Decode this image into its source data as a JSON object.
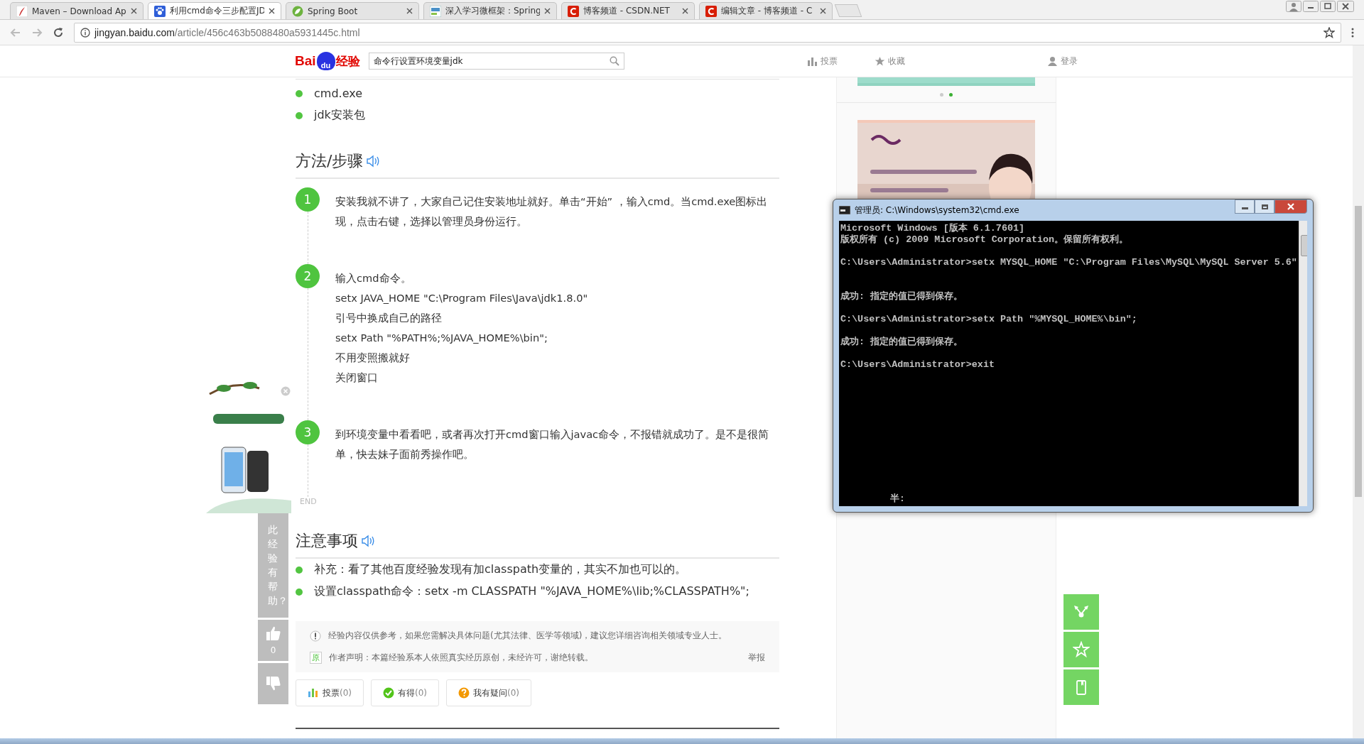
{
  "browser": {
    "tabs": [
      {
        "title": "Maven – Download Ap",
        "kind": "maven",
        "selected": false
      },
      {
        "title": "利用cmd命令三步配置JD",
        "kind": "paw",
        "selected": true
      },
      {
        "title": "Spring Boot",
        "kind": "leaf",
        "selected": false
      },
      {
        "title": "深入学习微框架：Spring",
        "kind": "info",
        "selected": false
      },
      {
        "title": "博客频道 - CSDN.NET",
        "kind": "csdn",
        "selected": false
      },
      {
        "title": "编辑文章 - 博客频道 - C",
        "kind": "csdn",
        "selected": false
      }
    ],
    "url": {
      "host": "jingyan.baidu.com",
      "path": "/article/456c463b5088480a5931445c.html"
    }
  },
  "header": {
    "logo": {
      "left": "Bai",
      "paw": "du",
      "right": "经验"
    },
    "search": {
      "value": "命令行设置环境变量jdk"
    },
    "nav": [
      {
        "label": "投票",
        "kind": "vote"
      },
      {
        "label": "收藏",
        "kind": "star"
      },
      {
        "label": "登录",
        "kind": "user"
      }
    ]
  },
  "article": {
    "tools": [
      "cmd.exe",
      "jdk安装包"
    ],
    "steps_heading": "方法/步骤",
    "steps": [
      {
        "number": "1",
        "lines": [
          "安装我就不讲了，大家自己记住安装地址就好。单击“开始” ，输入cmd。当cmd.exe图标出现，点击右键，选择以管理员身份运行。"
        ]
      },
      {
        "number": "2",
        "lines": [
          "输入cmd命令。",
          "setx JAVA_HOME \"C:\\Program Files\\Java\\jdk1.8.0\"",
          "引号中换成自己的路径",
          "setx Path \"%PATH%;%JAVA_HOME%\\bin\";",
          "不用变照搬就好",
          "关闭窗口"
        ]
      },
      {
        "number": "3",
        "lines": [
          "到环境变量中看看吧，或者再次打开cmd窗口输入javac命令，不报错就成功了。是不是很简单，快去妹子面前秀操作吧。"
        ]
      }
    ],
    "end_label": "END",
    "notes_heading": "注意事项",
    "notes": [
      "补充：看了其他百度经验发现有加classpath变量的，其实不加也可以的。",
      "设置classpath命令：setx -m CLASSPATH \"%JAVA_HOME%\\lib;%CLASSPATH%\";"
    ],
    "disclaimer": {
      "notice": "经验内容仅供参考，如果您需解决具体问题(尤其法律、医学等领域)，建议您详细咨询相关领域专业人士。",
      "badge": "原",
      "statement": "作者声明：本篇经验系本人依照真实经历原创，未经许可，谢绝转载。",
      "report": "举报"
    },
    "actions": [
      {
        "label": "投票",
        "count": "(0)",
        "kind": "vote"
      },
      {
        "label": "有得",
        "count": "(0)",
        "kind": "gain"
      },
      {
        "label": "我有疑问",
        "count": "(0)",
        "kind": "question"
      }
    ]
  },
  "helpful_bar": {
    "question": "此经验有帮助？",
    "likes": "0"
  },
  "sidebar": {
    "carousel_dots": [
      {
        "selected": false
      },
      {
        "selected": true
      }
    ]
  },
  "cmd_window": {
    "title": "管理员: C:\\Windows\\system32\\cmd.exe",
    "blocks": [
      [
        "Microsoft Windows [版本 6.1.7601]",
        "版权所有 (c) 2009 Microsoft Corporation。保留所有权利。"
      ],
      [
        "C:\\Users\\Administrator>setx MYSQL_HOME \"C:\\Program Files\\MySQL\\MySQL Server 5.6\""
      ],
      [
        "成功: 指定的值已得到保存。"
      ],
      [
        "C:\\Users\\Administrator>setx Path \"%MYSQL_HOME%\\bin\";"
      ],
      [
        "成功: 指定的值已得到保存。"
      ],
      [
        "C:\\Users\\Administrator>exit"
      ]
    ],
    "ime": "半:"
  },
  "side_actions": [
    {
      "kind": "share"
    },
    {
      "kind": "star"
    },
    {
      "kind": "bookmark"
    }
  ]
}
